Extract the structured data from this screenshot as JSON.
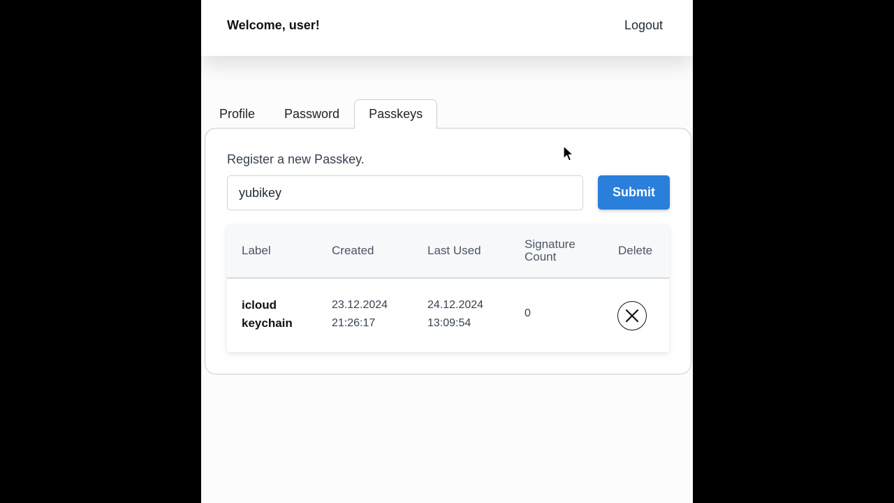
{
  "header": {
    "welcome": "Welcome, user!",
    "logout": "Logout"
  },
  "tabs": [
    {
      "label": "Profile",
      "active": false
    },
    {
      "label": "Password",
      "active": false
    },
    {
      "label": "Passkeys",
      "active": true
    }
  ],
  "passkeys": {
    "title": "Register a new Passkey.",
    "input_value": "yubikey",
    "submit_label": "Submit",
    "columns": [
      "Label",
      "Created",
      "Last Used",
      "Signature Count",
      "Delete"
    ],
    "rows": [
      {
        "label": "icloud keychain",
        "created": "23.12.2024 21:26:17",
        "last_used": "24.12.2024 13:09:54",
        "signature_count": "0",
        "delete_icon": "close-circle-icon"
      }
    ]
  },
  "colors": {
    "accent": "#2a7fdb",
    "page_background": "#000000",
    "panel_border": "#c8cdd3"
  }
}
